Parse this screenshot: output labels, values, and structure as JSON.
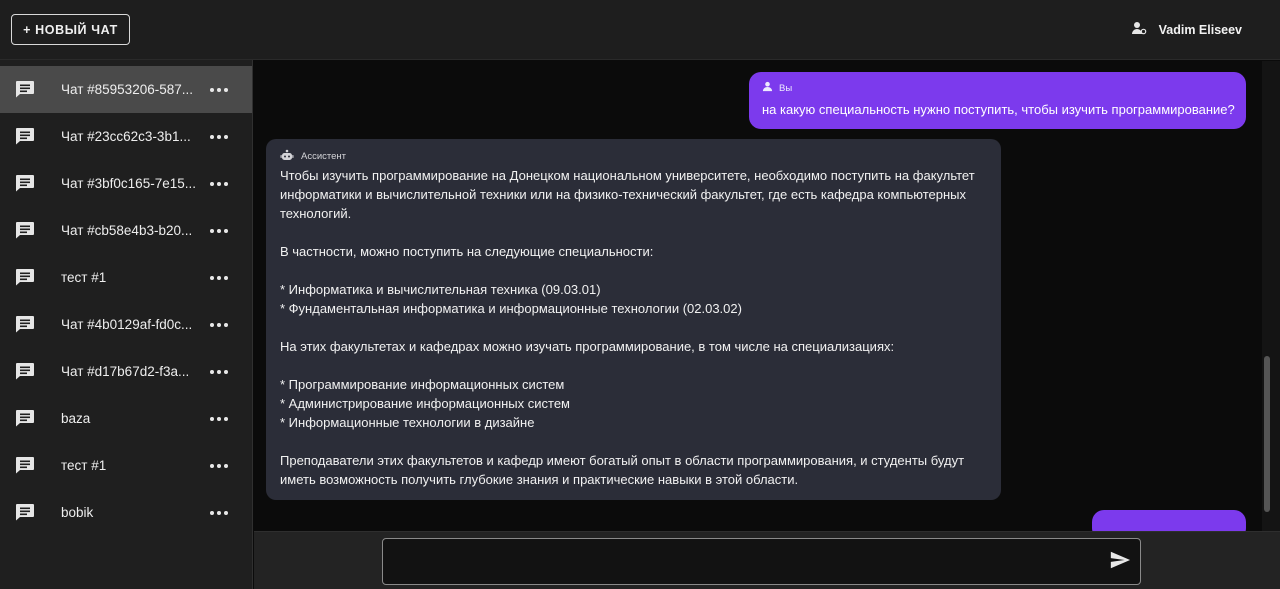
{
  "header": {
    "new_chat_label": "+ НОВЫЙ ЧАТ",
    "user_name": "Vadim Eliseev"
  },
  "sidebar": {
    "items": [
      {
        "label": "Чат #85953206-587...",
        "active": true
      },
      {
        "label": "Чат #23cc62c3-3b1...",
        "active": false
      },
      {
        "label": "Чат #3bf0c165-7e15...",
        "active": false
      },
      {
        "label": "Чат #cb58e4b3-b20...",
        "active": false
      },
      {
        "label": "тест #1",
        "active": false
      },
      {
        "label": "Чат #4b0129af-fd0c...",
        "active": false
      },
      {
        "label": "Чат #d17b67d2-f3a...",
        "active": false
      },
      {
        "label": "baza",
        "active": false
      },
      {
        "label": "тест #1",
        "active": false
      },
      {
        "label": "bobik",
        "active": false
      }
    ]
  },
  "conversation": {
    "user_message": {
      "author": "Вы",
      "text": "на какую специальность нужно поступить, чтобы изучить программирование?"
    },
    "assistant_message": {
      "author": "Ассистент",
      "lines": [
        "Чтобы изучить программирование на Донецком национальном университете, необходимо поступить на факультет",
        "информатики и вычислительной техники или на физико-технический факультет, где есть кафедра компьютерных",
        "технологий.",
        "",
        "В частности, можно поступить на следующие специальности:",
        "",
        "* Информатика и вычислительная техника (09.03.01)",
        "* Фундаментальная информатика и информационные технологии (02.03.02)",
        "",
        "На этих факультетах и кафедрах можно изучать программирование, в том числе на специализациях:",
        "",
        "* Программирование информационных систем",
        "* Администрирование информационных систем",
        "* Информационные технологии в дизайне",
        "",
        "Преподаватели этих факультетов и кафедр имеют богатый опыт в области программирования, и студенты будут",
        "иметь возможность получить глубокие знания и практические навыки в этой области."
      ]
    }
  },
  "composer": {
    "value": "",
    "placeholder": ""
  },
  "colors": {
    "accent": "#7c3aed",
    "assistant_bubble": "#2b2d38",
    "sidebar_bg": "#1f1f1f",
    "active_item": "#4a4a4a"
  }
}
